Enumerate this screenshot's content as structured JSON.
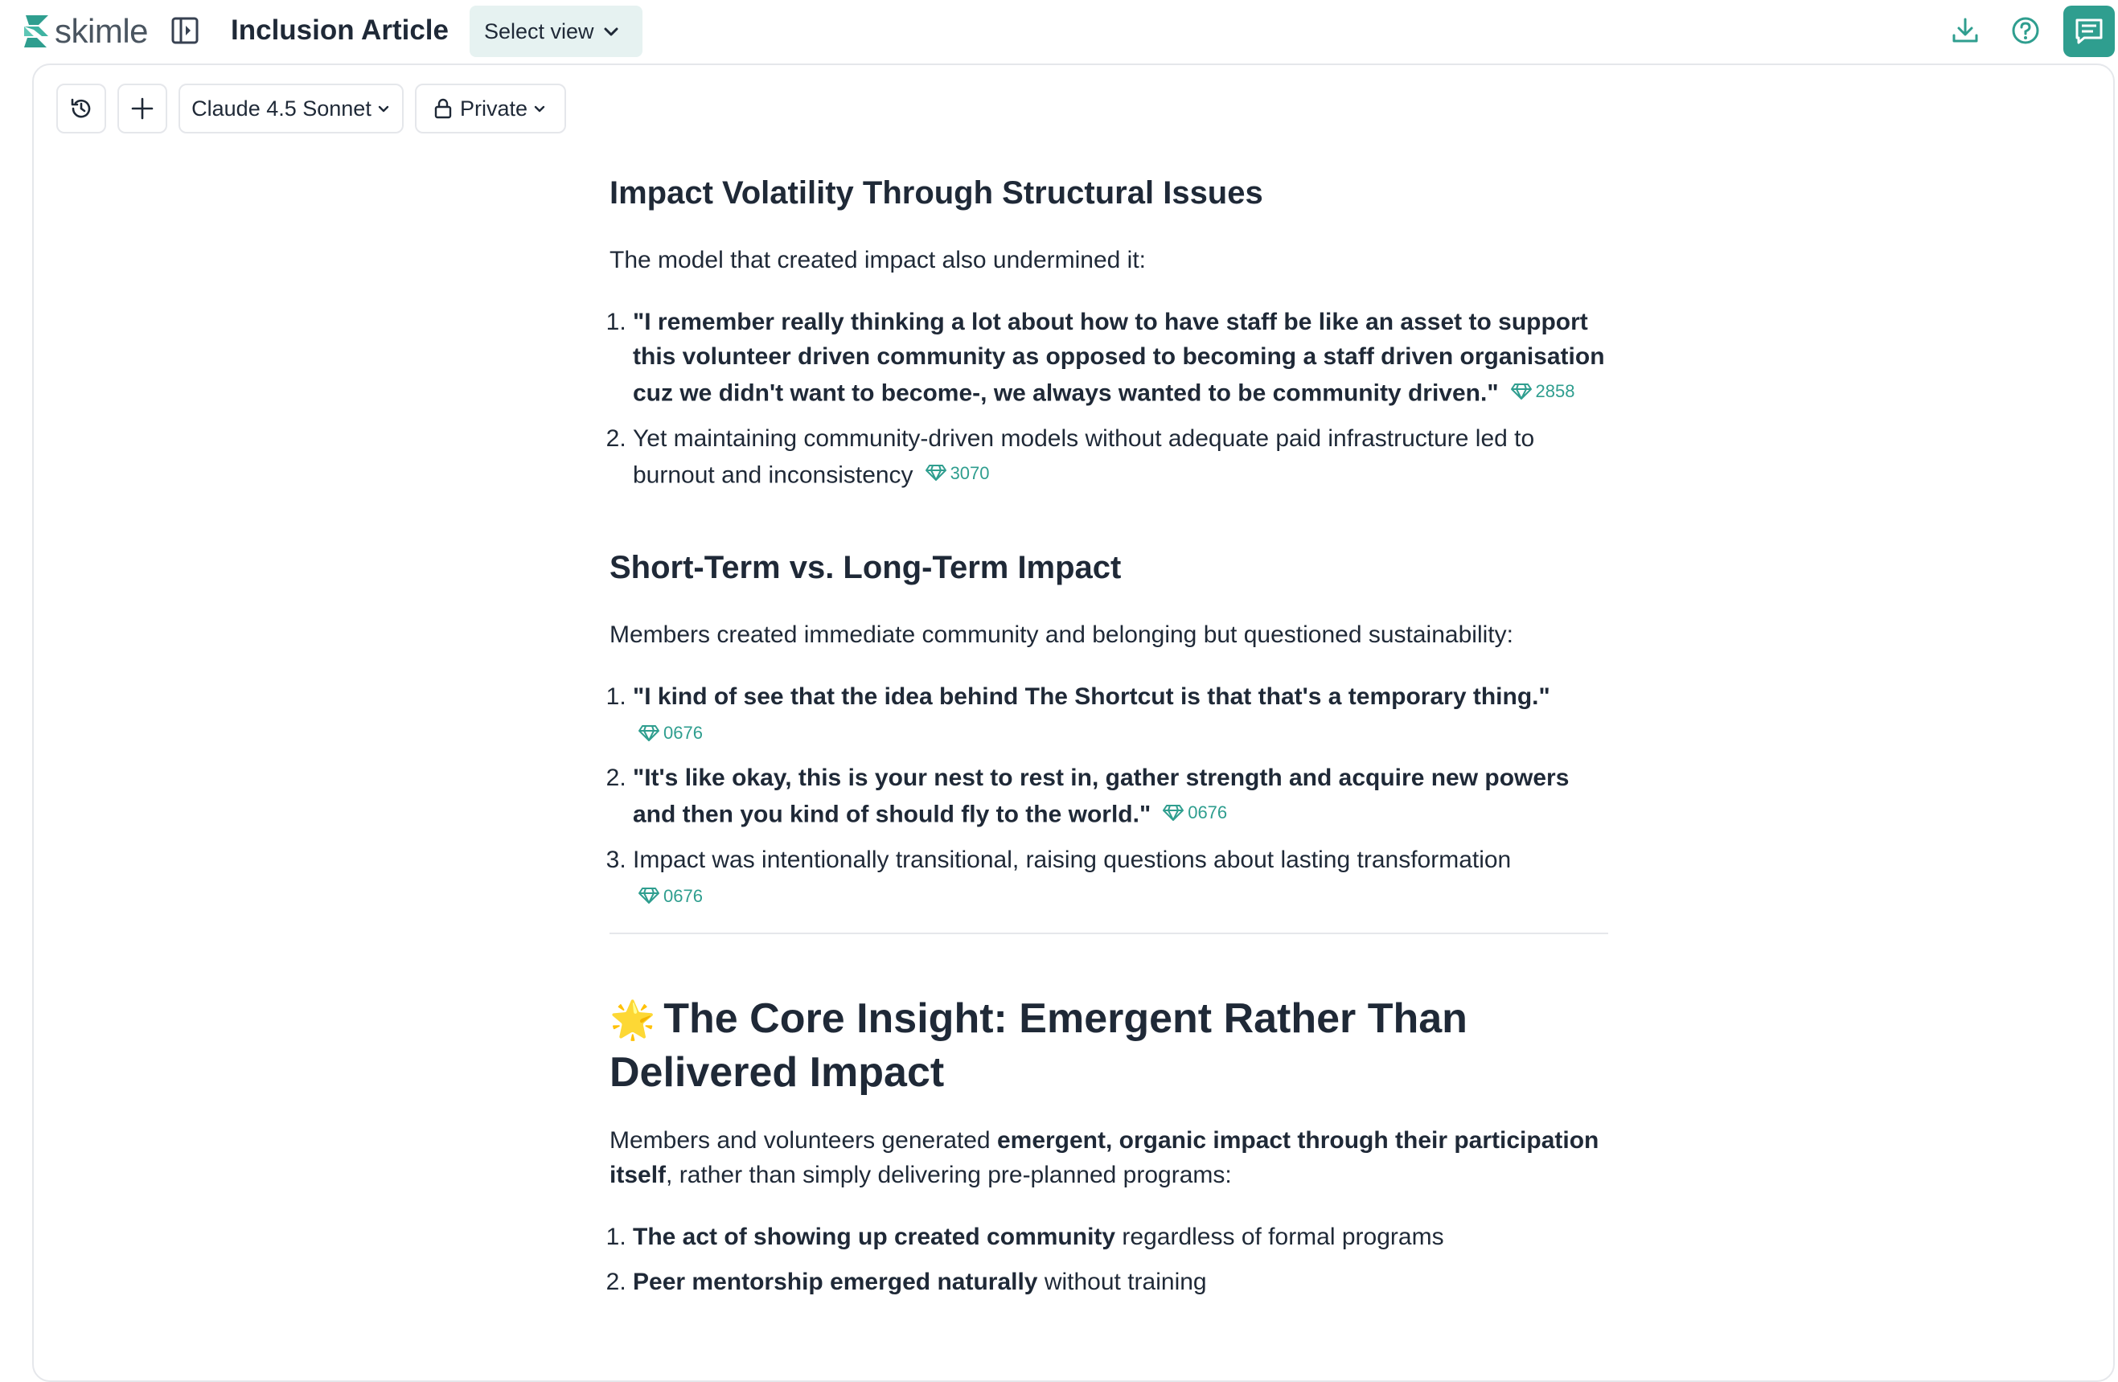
{
  "app": {
    "logo_text": "skimle",
    "doc_title": "Inclusion Article",
    "select_view_label": "Select view",
    "accent_color": "#2f9e8f"
  },
  "toolbar": {
    "history_icon": "history-icon",
    "add_icon": "plus-icon",
    "model_label": "Claude 4.5 Sonnet",
    "privacy_label": "Private"
  },
  "article": {
    "s1": {
      "heading": "Impact Volatility Through Structural Issues",
      "intro": "The model that created impact also undermined it:",
      "items": [
        {
          "text": "\"I remember really thinking a lot about how to have staff be like an asset to support this volunteer driven community as opposed to becoming a staff driven organisation cuz we didn't want to become-, we always wanted to be community driven.\"",
          "ref": "2858"
        },
        {
          "text": "Yet maintaining community-driven models without adequate paid infrastructure led to burnout and inconsistency",
          "ref": "3070"
        }
      ]
    },
    "s2": {
      "heading": "Short-Term vs. Long-Term Impact",
      "intro": "Members created immediate community and belonging but questioned sustainability:",
      "items": [
        {
          "text": "\"I kind of see that the idea behind The Shortcut is that that's a temporary thing.\"",
          "ref": "0676"
        },
        {
          "text": "\"It's like okay, this is your nest to rest in, gather strength and acquire new powers and then you kind of should fly to the world.\"",
          "ref": "0676"
        },
        {
          "text": "Impact was intentionally transitional, raising questions about lasting transformation",
          "ref": "0676"
        }
      ]
    },
    "s3": {
      "emoji": "🌟",
      "heading": "The Core Insight: Emergent Rather Than Delivered Impact",
      "intro_a": "Members and volunteers generated ",
      "intro_bold": "emergent, organic impact through their participation itself",
      "intro_b": ", rather than simply delivering pre-planned programs:",
      "items": [
        {
          "bold": "The act of showing up created community",
          "rest": " regardless of formal programs"
        },
        {
          "bold": "Peer mentorship emerged naturally",
          "rest": " without training"
        }
      ]
    }
  }
}
